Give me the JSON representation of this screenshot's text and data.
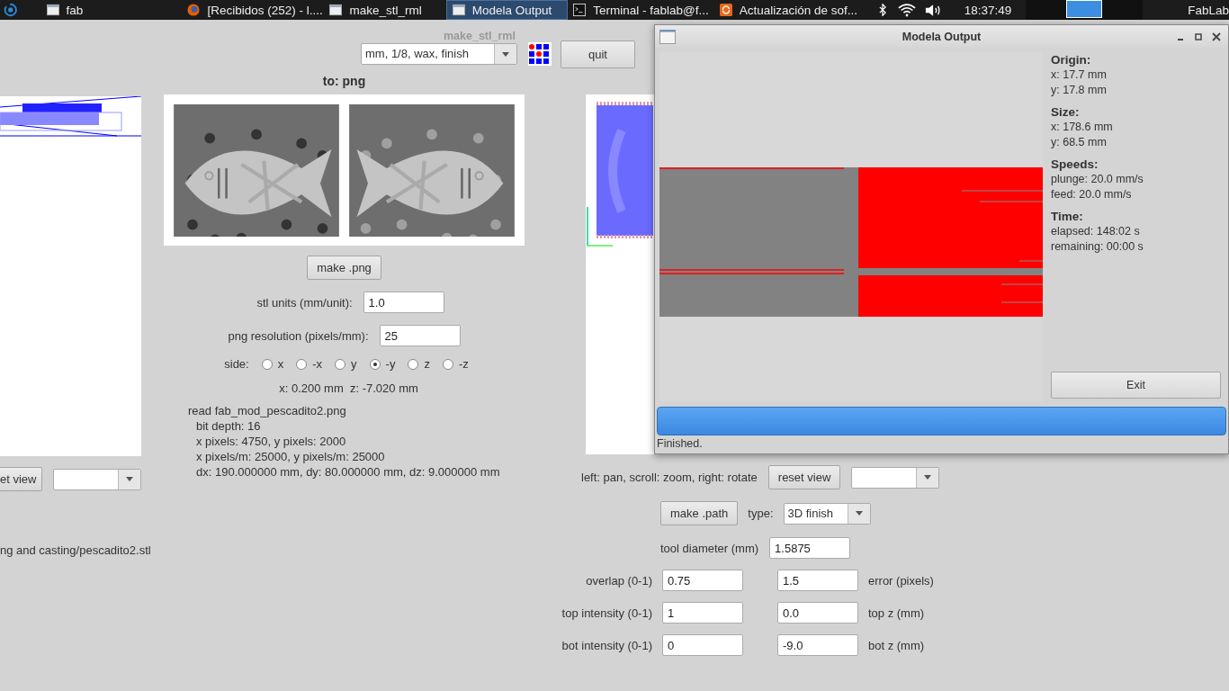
{
  "taskbar": {
    "items": [
      {
        "label": "fab",
        "kind": "window",
        "selected": false
      },
      {
        "label": "[Recibidos (252) - l....",
        "kind": "browser",
        "selected": false
      },
      {
        "label": "make_stl_rml",
        "kind": "window",
        "selected": false
      },
      {
        "label": "Modela Output",
        "kind": "window",
        "selected": true
      },
      {
        "label": "Terminal - fablab@f...",
        "kind": "terminal",
        "selected": false
      },
      {
        "label": "Actualización de sof...",
        "kind": "update",
        "selected": false
      }
    ],
    "clock": "18:37:49",
    "user": "FabLab"
  },
  "main_window": {
    "title": "make_stl_rml",
    "preset": "mm, 1/8, wax, finish",
    "quit": "quit",
    "to_label": "to: png",
    "left": {
      "reset_view": "et view",
      "path": "ng and casting/pescadito2.stl"
    },
    "png": {
      "make_button": "make .png",
      "fields": [
        {
          "label": "stl units (mm/unit):",
          "value": "1.0"
        },
        {
          "label": "png resolution (pixels/mm):",
          "value": "25"
        }
      ],
      "side_label": "side:",
      "sides": [
        {
          "label": "x",
          "selected": false
        },
        {
          "label": "-x",
          "selected": false
        },
        {
          "label": "y",
          "selected": false
        },
        {
          "label": "-y",
          "selected": true
        },
        {
          "label": "z",
          "selected": false
        },
        {
          "label": "-z",
          "selected": false
        }
      ],
      "position": "x: 0.200 mm  z: -7.020 mm",
      "info_title": "read fab_mod_pescadito2.png",
      "info_lines": [
        "bit depth: 16",
        "x pixels: 4750, y pixels: 2000",
        "x pixels/m: 25000, y pixels/m: 25000",
        "dx: 190.000000 mm, dy: 80.000000 mm, dz: 9.000000 mm"
      ]
    },
    "path": {
      "hint": "left: pan, scroll: zoom, right: rotate",
      "reset_view": "reset view",
      "make_button": "make .path",
      "type_label": "type:",
      "type_value": "3D finish",
      "tool_diameter": {
        "label": "tool diameter (mm)",
        "value": "1.5875"
      },
      "rows": [
        {
          "left_label": "overlap (0-1)",
          "left_value": "0.75",
          "right_value": "1.5",
          "right_label": "error (pixels)"
        },
        {
          "left_label": "top intensity (0-1)",
          "left_value": "1",
          "right_value": "0.0",
          "right_label": "top z (mm)"
        },
        {
          "left_label": "bot intensity (0-1)",
          "left_value": "0",
          "right_value": "-9.0",
          "right_label": "bot z (mm)"
        }
      ]
    }
  },
  "modela_window": {
    "title": "Modela Output",
    "sections": [
      {
        "heading": "Origin:",
        "lines": [
          "x: 17.7 mm",
          "y: 17.8 mm"
        ]
      },
      {
        "heading": "Size:",
        "lines": [
          "x: 178.6 mm",
          "y: 68.5 mm"
        ]
      },
      {
        "heading": "Speeds:",
        "lines": [
          "plunge: 20.0 mm/s",
          "feed: 20.0 mm/s"
        ]
      },
      {
        "heading": "Time:",
        "lines": [
          "elapsed: 148:02 s",
          "remaining: 00:00 s"
        ]
      }
    ],
    "exit": "Exit",
    "progress": {
      "level": 1
    },
    "status": "Finished."
  }
}
